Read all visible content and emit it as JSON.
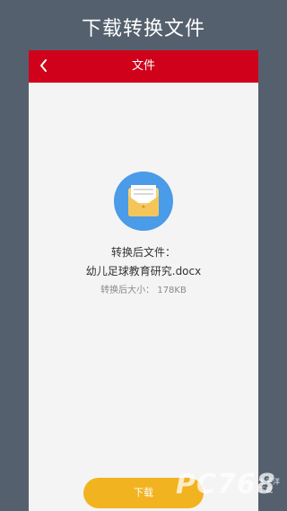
{
  "banner": {
    "title": "下载转换文件"
  },
  "navbar": {
    "title": "文件",
    "back_icon": "chevron-left-icon"
  },
  "file": {
    "icon": "envelope-folder-icon",
    "label": "转换后文件：",
    "name": "幼儿足球教育研究.docx",
    "size_text": "转换后大小：  178KB"
  },
  "actions": {
    "download_label": "下载"
  },
  "watermark": {
    "text": "PC768",
    "sub": "太平洋下载"
  },
  "colors": {
    "navbar": "#d0021b",
    "button": "#f2b320",
    "icon_circle": "#4a9be8",
    "background": "#55606e"
  }
}
